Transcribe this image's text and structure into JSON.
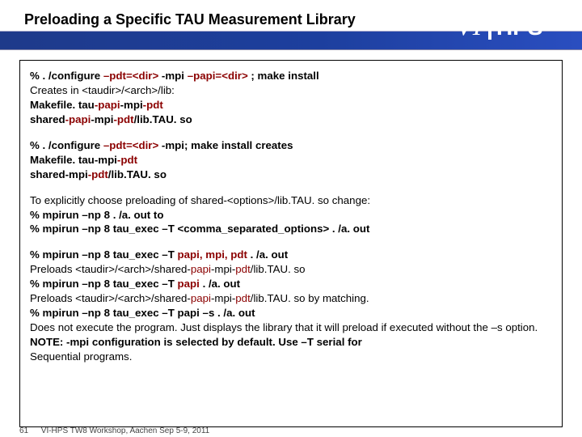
{
  "slide": {
    "title": "Preloading a Specific TAU Measurement Library"
  },
  "logo": {
    "prefix": "VI",
    "suffix": "HPS"
  },
  "box": {
    "l1_a": "% . /configure ",
    "l1_b": "–pdt=<dir>",
    "l1_c": " -mpi ",
    "l1_d": "–papi=<dir>",
    "l1_e": " ; make install",
    "l2": "Creates in <taudir>/<arch>/lib:",
    "l3_a": "Makefile. tau",
    "l3_b": "-papi",
    "l3_c": "-mpi",
    "l3_d": "-pdt",
    "l4_a": "shared",
    "l4_b": "-papi",
    "l4_c": "-mpi",
    "l4_d": "-pdt",
    "l4_e": "/lib.TAU. so",
    "l5_a": "% . /configure ",
    "l5_b": "–pdt=<dir>",
    "l5_c": " -mpi; make install  creates",
    "l6_a": "Makefile. tau",
    "l6_b": "-mpi",
    "l6_c": "-pdt",
    "l7_a": "shared",
    "l7_b": "-mpi",
    "l7_c": "-pdt",
    "l7_d": "/lib.TAU. so",
    "l8": "To explicitly choose preloading of shared-<options>/lib.TAU. so change:",
    "l9": "% mpirun –np 8 . /a. out     to",
    "l10": "% mpirun –np 8 tau_exec –T <comma_separated_options> . /a. out",
    "l11_a": "% mpirun –np 8 tau_exec –T ",
    "l11_b": "papi, mpi, pdt",
    "l11_c": " . /a. out",
    "l12_a": "Preloads <taudir>/<arch>/shared-",
    "l12_b": "papi",
    "l12_c": "-mpi-",
    "l12_d": "pdt",
    "l12_e": "/lib.TAU. so",
    "l13_a": "% mpirun –np 8 tau_exec –T ",
    "l13_b": "papi",
    "l13_c": " . /a. out",
    "l14_a": "Preloads <taudir>/<arch>/shared-",
    "l14_b": "papi",
    "l14_c": "-mpi-",
    "l14_d": "pdt",
    "l14_e": "/lib.TAU. so by matching.",
    "l15": "% mpirun –np 8 tau_exec –T papi –s . /a. out",
    "l16": "Does not execute the program. Just displays the library that it will preload if executed without the –s option.",
    "l17": "NOTE: -mpi configuration is selected by default. Use –T serial for",
    "l18": "Sequential programs."
  },
  "footer": {
    "page": "61",
    "text": "VI-HPS TW8 Workshop, Aachen Sep 5-9, 2011"
  }
}
